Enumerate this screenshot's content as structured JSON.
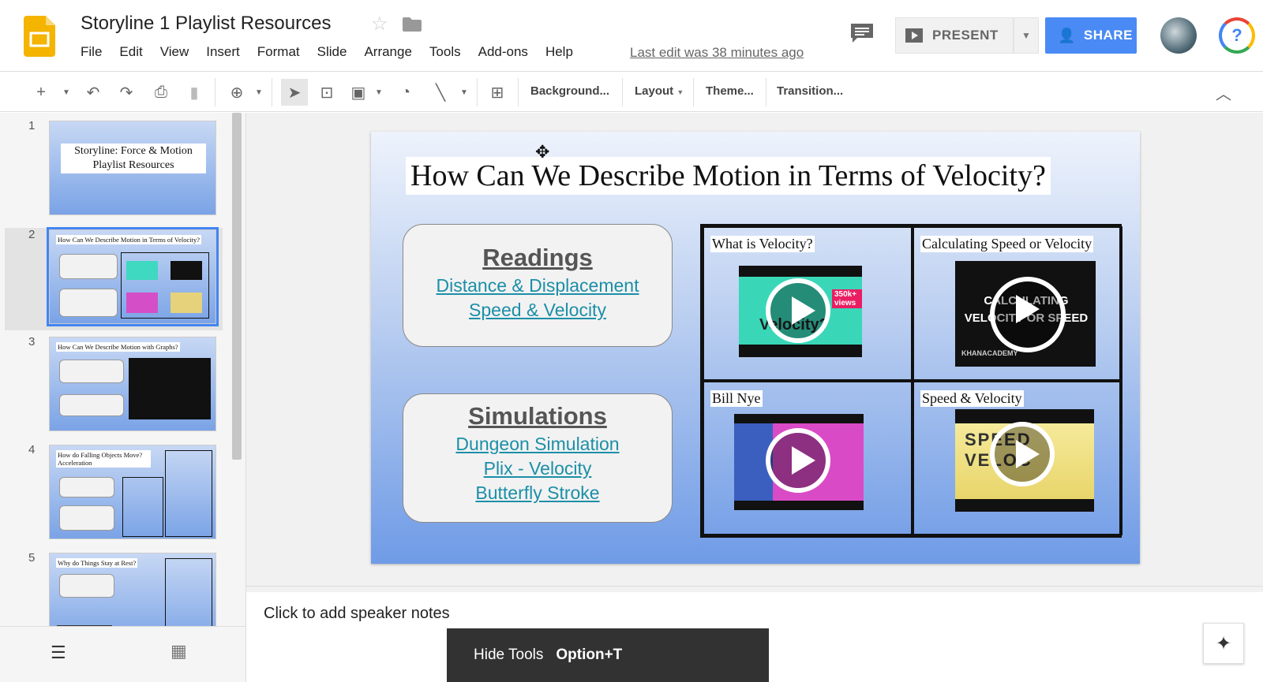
{
  "app": {
    "doc_title": "Storyline 1 Playlist Resources",
    "last_edit": "Last edit was 38 minutes ago",
    "menu": [
      "File",
      "Edit",
      "View",
      "Insert",
      "Format",
      "Slide",
      "Arrange",
      "Tools",
      "Add-ons",
      "Help"
    ],
    "present_label": "PRESENT",
    "share_label": "SHARE",
    "help_glyph": "?"
  },
  "toolbar": {
    "background_label": "Background...",
    "layout_label": "Layout",
    "theme_label": "Theme...",
    "transition_label": "Transition..."
  },
  "filmstrip": {
    "slides": [
      {
        "num": "1",
        "title": "Storyline: Force & Motion Playlist Resources"
      },
      {
        "num": "2",
        "title": "How Can We Describe Motion in Terms of Velocity?"
      },
      {
        "num": "3",
        "title": "How Can We Describe Motion with Graphs?"
      },
      {
        "num": "4",
        "title": "How do Falling Objects Move? Acceleration"
      },
      {
        "num": "5",
        "title": "Why do Things Stay at Rest?"
      }
    ],
    "selected": 2
  },
  "slide": {
    "title": "How Can We Describe Motion in Terms of Velocity?",
    "readings": {
      "heading": "Readings",
      "links": [
        "Distance & Displacement",
        "Speed & Velocity"
      ]
    },
    "simulations": {
      "heading": "Simulations",
      "links": [
        "Dungeon Simulation",
        "Plix - Velocity",
        "Butterfly Stroke"
      ]
    },
    "videos": [
      {
        "label": "What is Velocity?",
        "overlay": "Velocity?",
        "badge": "350k+ views"
      },
      {
        "label": "Calculating Speed or Velocity",
        "overlay": "CALCULATING VELOCITY OR SPEED",
        "badge": "KHANACADEMY"
      },
      {
        "label": "Bill Nye",
        "overlay": "",
        "badge": ""
      },
      {
        "label": "Speed & Velocity",
        "overlay": "SPEED VELOC",
        "badge": ""
      }
    ]
  },
  "notes": {
    "placeholder": "Click to add speaker notes"
  },
  "tooltip": {
    "text": "Hide Tools",
    "shortcut": "Option+T"
  }
}
